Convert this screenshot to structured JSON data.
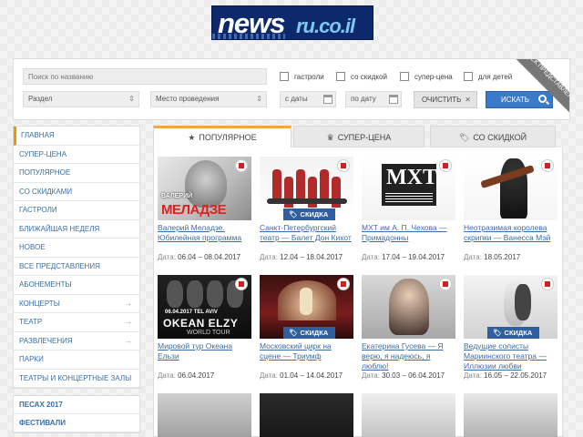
{
  "logo": {
    "news": "news",
    "domain": "ru.co.il"
  },
  "search": {
    "name_placeholder": "Поиск по названию",
    "section": "Раздел",
    "venue": "Место проведения",
    "date_from": "с даты",
    "date_to": "по дату",
    "clear": "ОЧИСТИТЬ",
    "search": "ИСКАТЬ",
    "ribbon": "ПОИСК ПРЕДСТАВЛЕНИЯ",
    "checks": [
      "гастроли",
      "со скидкой",
      "супер-цена",
      "для детей"
    ]
  },
  "sidebar": [
    {
      "label": "ГЛАВНАЯ",
      "arrow": false
    },
    {
      "label": "СУПЕР-ЦЕНА",
      "arrow": false
    },
    {
      "label": "ПОПУЛЯРНОЕ",
      "arrow": false
    },
    {
      "label": "СО СКИДКАМИ",
      "arrow": false
    },
    {
      "label": "ГАСТРОЛИ",
      "arrow": false
    },
    {
      "label": "БЛИЖАЙШАЯ НЕДЕЛЯ",
      "arrow": false
    },
    {
      "label": "НОВОЕ",
      "arrow": false
    },
    {
      "label": "ВСЕ ПРЕДСТАВЛЕНИЯ",
      "arrow": false
    },
    {
      "label": "АБОНЕМЕНТЫ",
      "arrow": false
    },
    {
      "label": "КОНЦЕРТЫ",
      "arrow": true
    },
    {
      "label": "ТЕАТР",
      "arrow": true
    },
    {
      "label": "РАЗВЛЕЧЕНИЯ",
      "arrow": true
    },
    {
      "label": "ПАРКИ",
      "arrow": false
    },
    {
      "label": "ТЕАТРЫ И КОНЦЕРТНЫЕ ЗАЛЫ",
      "arrow": false
    }
  ],
  "sidebar2": [
    "ПЕСАХ 2017",
    "ФЕСТИВАЛИ"
  ],
  "tabs": [
    "ПОПУЛЯРНОЕ",
    "СУПЕР-ЦЕНА",
    "СО СКИДКОЙ"
  ],
  "date_label": "Дата:",
  "discount_label": "СКИДКА",
  "cards": [
    {
      "title": "Валерий Меладзе. Юбилейная программа",
      "date": "06.04 – 08.04.2017",
      "discount": false,
      "art": "МЕЛАДЗЕ",
      "art_pre": "ВАЛЕРИЙ"
    },
    {
      "title": "Санкт-Петербургский театр — Балет Дон Кихот",
      "date": "12.04 – 18.04.2017",
      "discount": true
    },
    {
      "title": "МХТ им А. П. Чехова — Примадонны",
      "date": "17.04 – 19.04.2017",
      "discount": false,
      "art": "МХТ"
    },
    {
      "title": "Неотразимая королева скрипки — Ванесса Мэй",
      "date": "18.05.2017",
      "discount": false
    },
    {
      "title": "Мировой тур Океана Ельзи",
      "date": "06.04.2017",
      "discount": false,
      "art": "OKEAN ELZY",
      "art_pre": "06.04.2017  TEL AVIV",
      "art_sub": "WORLD TOUR"
    },
    {
      "title": "Московский цирк на сцене — Триумф",
      "date": "01.04 – 14.04.2017",
      "discount": true
    },
    {
      "title": "Екатерина Гусева — Я верю, я надеюсь, я люблю!",
      "date": "30.03 – 06.04.2017",
      "discount": false
    },
    {
      "title": "Ведущие солисты Мариинского театра — Иллюзии любви",
      "date": "16.05 – 22.05.2017",
      "discount": true
    }
  ],
  "colors": {
    "accent": "#f29400",
    "link": "#3a6ea5",
    "search_btn": "#3a7ac9",
    "discount": "#2f5f9f"
  }
}
